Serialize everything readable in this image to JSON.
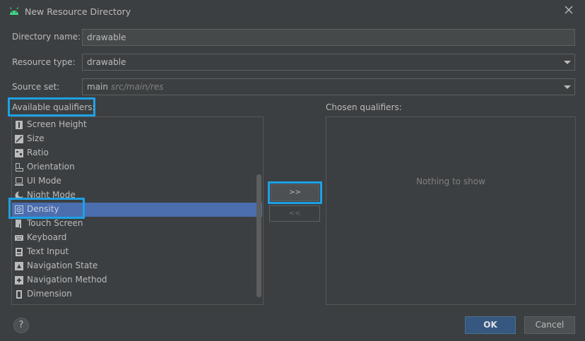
{
  "window": {
    "title": "New Resource Directory"
  },
  "form": {
    "directory_name_label": "Directory name:",
    "directory_name_value": "drawable",
    "resource_type_label": "Resource type:",
    "resource_type_value": "drawable",
    "source_set_label": "Source set:",
    "source_set_value": "main",
    "source_set_hint": "src/main/res"
  },
  "available": {
    "label": "Available qualifiers:",
    "items": [
      {
        "label": "Screen Height",
        "icon": "screen-height-icon"
      },
      {
        "label": "Size",
        "icon": "size-icon"
      },
      {
        "label": "Ratio",
        "icon": "ratio-icon"
      },
      {
        "label": "Orientation",
        "icon": "orientation-icon"
      },
      {
        "label": "UI Mode",
        "icon": "ui-mode-icon"
      },
      {
        "label": "Night Mode",
        "icon": "night-mode-icon"
      },
      {
        "label": "Density",
        "icon": "density-icon"
      },
      {
        "label": "Touch Screen",
        "icon": "touch-screen-icon"
      },
      {
        "label": "Keyboard",
        "icon": "keyboard-icon"
      },
      {
        "label": "Text Input",
        "icon": "text-input-icon"
      },
      {
        "label": "Navigation State",
        "icon": "navigation-state-icon"
      },
      {
        "label": "Navigation Method",
        "icon": "navigation-method-icon"
      },
      {
        "label": "Dimension",
        "icon": "dimension-icon"
      }
    ],
    "selected_index": 6
  },
  "transfer": {
    "add_label": ">>",
    "remove_label": "<<"
  },
  "chosen": {
    "label": "Chosen qualifiers:",
    "empty_text": "Nothing to show"
  },
  "footer": {
    "help_label": "?",
    "ok_label": "OK",
    "cancel_label": "Cancel"
  },
  "colors": {
    "background": "#3c3f41",
    "selection": "#4b6eaf",
    "highlight": "#1da1e6",
    "ok_button": "#365880"
  }
}
